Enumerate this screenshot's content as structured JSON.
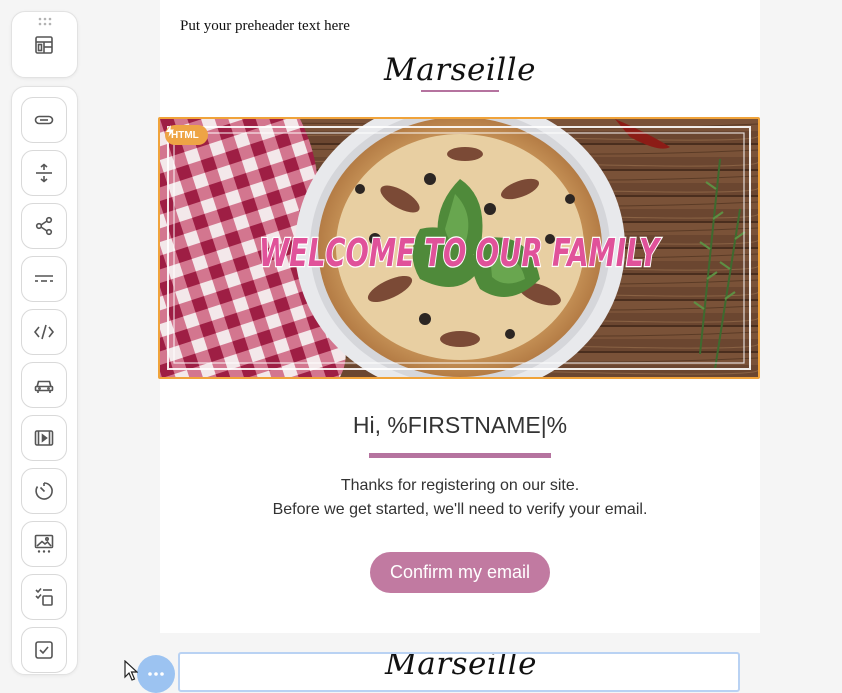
{
  "toolbar": {
    "top_icon": "layout-blocks-icon",
    "items": [
      {
        "name": "button-block",
        "icon": "button-icon"
      },
      {
        "name": "spacer-block",
        "icon": "spacer-icon"
      },
      {
        "name": "social-block",
        "icon": "share-icon"
      },
      {
        "name": "divider-block",
        "icon": "divider-icon"
      },
      {
        "name": "html-block",
        "icon": "code-icon"
      },
      {
        "name": "banner-block",
        "icon": "car-icon"
      },
      {
        "name": "video-block",
        "icon": "video-icon"
      },
      {
        "name": "timer-block",
        "icon": "timer-icon"
      },
      {
        "name": "image-gallery-block",
        "icon": "image-gallery-icon"
      },
      {
        "name": "menu-block",
        "icon": "menu-list-icon"
      },
      {
        "name": "checkbox-block",
        "icon": "checkbox-icon"
      }
    ]
  },
  "email": {
    "preheader": "Put your preheader text here",
    "logo": "Marseille",
    "banner": {
      "badge": "HTML",
      "headline": "WELCOME TO OUR FAMILY"
    },
    "greeting": "Hi, %FIRSTNAME|%",
    "line1": "Thanks for registering on our site.",
    "line2": "Before we get started, we'll need to verify your email.",
    "button": "Confirm my email"
  },
  "next_block": {
    "logo": "Marseille",
    "more_icon": "ellipsis-icon"
  },
  "colors": {
    "accent": "#c17aa1",
    "selection": "#f0a33a",
    "headline_pink": "#e0529a"
  }
}
